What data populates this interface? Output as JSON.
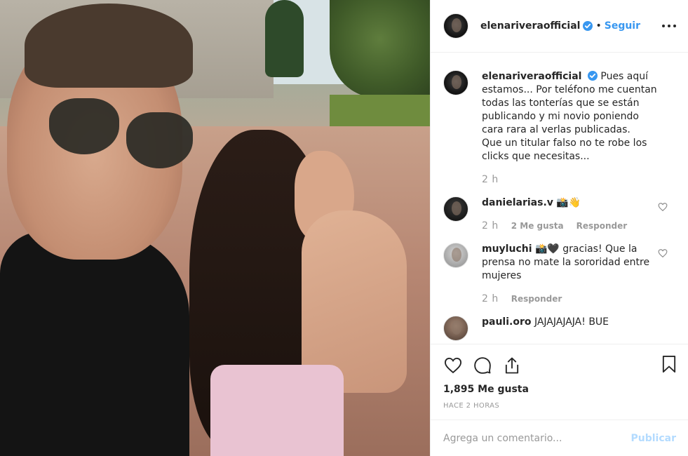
{
  "post": {
    "author": "elenariveraofficial",
    "follow_label": "Seguir",
    "separator": "•",
    "caption_lines": [
      "Pues aquí estamos... Por teléfono me cuentan todas las tonterías que se están publicando y mi novio poniendo cara rara al verlas publicadas.",
      "Que un titular falso no te robe los clicks que necesitas..."
    ],
    "caption_time": "2 h"
  },
  "comments": [
    {
      "user": "danielarias.v",
      "text": "📸👋",
      "time": "2 h",
      "likes": "2 Me gusta",
      "reply": "Responder"
    },
    {
      "user": "muyluchi",
      "text": "📸🖤 gracias! Que la prensa no mate la sororidad entre mujeres",
      "time": "2 h",
      "reply": "Responder"
    },
    {
      "user": "pauli.oro",
      "text": "JAJAJAJAJA! BUE"
    }
  ],
  "stats": {
    "likes": "1,895 Me gusta",
    "time_ago": "HACE 2 HORAS"
  },
  "comment_box": {
    "placeholder": "Agrega un comentario...",
    "publish_label": "Publicar"
  },
  "colors": {
    "accent": "#3897f0",
    "publish_disabled": "#b3dbff",
    "muted": "#999999"
  },
  "icons": [
    "heart-icon",
    "comment-icon",
    "share-icon",
    "bookmark-icon",
    "more-icon",
    "verified-icon"
  ]
}
